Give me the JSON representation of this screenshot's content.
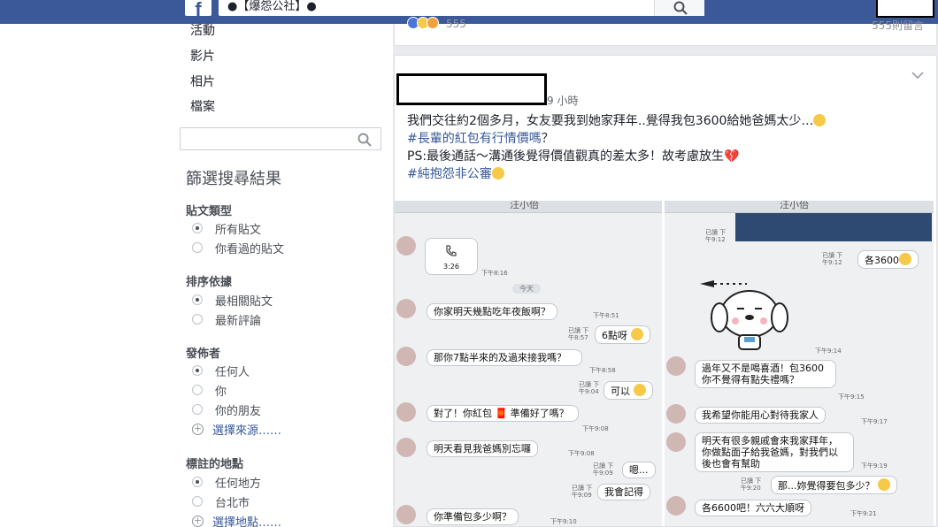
{
  "header": {
    "logo": "f",
    "search_value": "●【爆怨公社】●"
  },
  "top_card": {
    "reaction_count": "555",
    "comment_text": "555則留言"
  },
  "sidebar": {
    "nav": [
      "活動",
      "影片",
      "相片",
      "檔案"
    ],
    "search_placeholder": "",
    "filter_title": "篩選搜尋結果",
    "sections": [
      {
        "title": "貼文類型",
        "options": [
          "所有貼文",
          "你看過的貼文"
        ],
        "selected": 0
      },
      {
        "title": "排序依據",
        "options": [
          "最相關貼文",
          "最新評論"
        ],
        "selected": 0
      },
      {
        "title": "發佈者",
        "options": [
          "任何人",
          "你",
          "你的朋友"
        ],
        "selected": 0,
        "choose": "選擇來源……"
      },
      {
        "title": "標註的地點",
        "options": [
          "任何地方",
          "台北市"
        ],
        "selected": 0,
        "choose": "選擇地點……"
      }
    ]
  },
  "post": {
    "time": "9 小時",
    "line1": "我們交往約2個多月，女友要我到她家拜年..覺得我包3600給她爸媽太少…",
    "hashtag1": "#長輩的紅包有行情價嗎",
    "q": "？",
    "line2": "PS:最後通話～溝通後覺得價值觀真的差太多！故考慮放生",
    "hashtag2": "#純抱怨非公審"
  },
  "chat_left": {
    "name": "汪小佁",
    "call_duration": "3:26",
    "call_time": "下午8:16",
    "today": "今天",
    "messages": [
      {
        "text": "你家明天幾點吃年夜飯啊？",
        "time": "下午8:51"
      },
      {
        "text": "6點呀",
        "time": "已讀 下午8:57"
      },
      {
        "text": "那你7點半來的及過來接我嗎？",
        "time": "下午8:58"
      },
      {
        "text": "可以",
        "time": "已讀 下午9:04"
      },
      {
        "text": "對了！你紅包 🧧 準備好了嗎？",
        "time": "下午9:08"
      },
      {
        "text": "明天看見我爸媽別忘囉",
        "time": "下午9:08"
      },
      {
        "text": "嗯...",
        "time": "已讀 下午9:09"
      },
      {
        "text": "我會記得",
        "time": "已讀 下午9:09"
      },
      {
        "text": "你準備包多少啊？",
        "time": "下午9:10"
      }
    ]
  },
  "chat_right": {
    "name": "汪小佁",
    "messages": [
      {
        "text": "各3600",
        "time": "已讀 下午9:12"
      },
      {
        "text": "過年又不是喝喜酒！包3600你不覺得有點失禮嗎？",
        "time": "下午9:15"
      },
      {
        "text": "我希望你能用心對待我家人",
        "time": "下午9:17"
      },
      {
        "text": "明天有很多親戚會來我家拜年，你做點面子給我爸媽，對我們以後也會有幫助",
        "time": "下午9:19"
      },
      {
        "text": "那...妳覺得要包多少？",
        "time": "已讀 下午9:20"
      },
      {
        "text": "各6600吧！六六大順呀",
        "time": "下午9:21"
      }
    ],
    "first_time": "已讀 下午9:12",
    "sticker_time": "下午9:14"
  },
  "colors": {
    "fb_blue": "#3b5998",
    "link": "#365899",
    "bg": "#e9ebee"
  }
}
